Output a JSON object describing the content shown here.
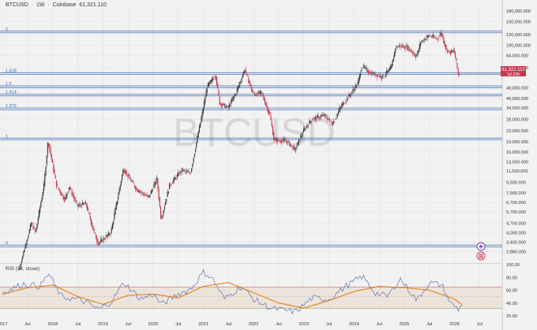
{
  "header": {
    "symbol": "BTCUSD",
    "sep": "·",
    "interval": "1W",
    "exchange": "Coinbase",
    "last": "61,321.110"
  },
  "watermark": "BTCUSD",
  "price_tag": {
    "value": "61,321.110",
    "countdown": "1d 23h"
  },
  "rsi_label": "RSI (14, close)",
  "colors": {
    "background": "#f2f2f2",
    "up": "#3a3a3a",
    "down": "#c8384f",
    "fib": "#2e5fb0",
    "rsi": "#6a7fb8",
    "rsi_ma": "#e07e1a",
    "rsi_band": "#e8d9c8",
    "upper_line": "#c86a6a"
  },
  "chart_data": [
    {
      "type": "line",
      "title": "BTCUSD",
      "scale": "log",
      "ylim": [
        2400,
        190000
      ],
      "x_ticks": [
        "2017",
        "Jul",
        "2018",
        "Jul",
        "2019",
        "Jul",
        "2020",
        "Jul",
        "2021",
        "Jul",
        "2022",
        "Jul",
        "2023",
        "Jul",
        "2024",
        "Jul",
        "2025",
        "Jul",
        "2026",
        "Jul"
      ],
      "y_ticks": [
        {
          "value": 180000,
          "label": "180,000.000"
        },
        {
          "value": 150000,
          "label": "150,000.000"
        },
        {
          "value": 120000,
          "label": "120,000.000"
        },
        {
          "value": 100000,
          "label": "100,000.000"
        },
        {
          "value": 84000,
          "label": "84,000.000"
        },
        {
          "value": 68000,
          "label": "68,000.000"
        },
        {
          "value": 48000,
          "label": "48,000.000"
        },
        {
          "value": 40000,
          "label": "40,000.000"
        },
        {
          "value": 34000,
          "label": "34,000.000"
        },
        {
          "value": 28000,
          "label": "28,000.000"
        },
        {
          "value": 23000,
          "label": "23,000.000"
        },
        {
          "value": 19000,
          "label": "19,000.000"
        },
        {
          "value": 16000,
          "label": "16,000.000"
        },
        {
          "value": 13500,
          "label": "13,500.000"
        },
        {
          "value": 11500,
          "label": "11,500.000"
        },
        {
          "value": 9500,
          "label": "9,500.000"
        },
        {
          "value": 7900,
          "label": "7,900.000"
        },
        {
          "value": 6700,
          "label": "6,700.000"
        },
        {
          "value": 5700,
          "label": "5,700.000"
        },
        {
          "value": 4700,
          "label": "4,700.000"
        },
        {
          "value": 4000,
          "label": "4,000.000"
        },
        {
          "value": 3400,
          "label": "3,400.000"
        },
        {
          "value": 2880,
          "label": "2,880.000"
        }
      ],
      "fib_levels": [
        {
          "label": "2",
          "price": 126000
        },
        {
          "label": "1.618",
          "price": 61500
        },
        {
          "label": "1.5",
          "price": 49000
        },
        {
          "label": "1.414",
          "price": 42500
        },
        {
          "label": "1.272",
          "price": 33500
        },
        {
          "label": "1",
          "price": 20000
        },
        {
          "label": "0",
          "price": 3180
        }
      ],
      "series": [
        {
          "x": [
            "2017-05",
            "2017-08",
            "2017-09",
            "2017-11",
            "2017-12",
            "2018-02",
            "2018-04",
            "2018-05",
            "2018-07",
            "2018-09",
            "2018-11",
            "2018-12",
            "2019-03",
            "2019-06",
            "2019-09",
            "2019-12",
            "2020-02",
            "2020-03",
            "2020-05",
            "2020-08",
            "2020-10",
            "2020-12",
            "2021-01",
            "2021-02",
            "2021-04",
            "2021-05",
            "2021-07",
            "2021-09",
            "2021-11",
            "2022-01",
            "2022-03",
            "2022-05",
            "2022-06",
            "2022-09",
            "2022-11",
            "2023-01",
            "2023-03",
            "2023-06",
            "2023-08",
            "2023-10",
            "2023-12",
            "2024-02",
            "2024-03",
            "2024-05",
            "2024-08",
            "2024-10",
            "2024-11",
            "2024-12",
            "2025-02",
            "2025-04",
            "2025-05",
            "2025-07",
            "2025-09",
            "2025-10",
            "2025-11",
            "2025-12",
            "2026-01",
            "2026-02"
          ],
          "values": [
            2100,
            4700,
            4000,
            9000,
            19500,
            9000,
            7000,
            8800,
            6300,
            6600,
            4000,
            3300,
            4000,
            12000,
            8500,
            7300,
            10000,
            5000,
            9000,
            11700,
            11000,
            23000,
            33000,
            49000,
            60000,
            37000,
            34000,
            45000,
            66000,
            43000,
            44000,
            30000,
            19500,
            19300,
            16500,
            23000,
            28000,
            30000,
            26000,
            35000,
            42000,
            52000,
            70000,
            62000,
            58000,
            68000,
            96000,
            99000,
            96000,
            82000,
            105000,
            118000,
            112000,
            124000,
            95000,
            88000,
            91000,
            61000
          ]
        }
      ]
    },
    {
      "type": "line",
      "title": "RSI (14, close)",
      "ylim": [
        20,
        100
      ],
      "y_ticks": [
        100,
        80,
        60,
        40,
        20
      ],
      "series": [
        {
          "name": "RSI",
          "x": [
            "2017-01",
            "2017-06",
            "2017-10",
            "2017-12",
            "2018-03",
            "2018-08",
            "2018-12",
            "2019-03",
            "2019-06",
            "2019-10",
            "2020-01",
            "2020-03",
            "2020-07",
            "2020-10",
            "2021-01",
            "2021-03",
            "2021-06",
            "2021-10",
            "2022-01",
            "2022-05",
            "2022-11",
            "2023-03",
            "2023-07",
            "2023-11",
            "2024-03",
            "2024-06",
            "2024-09",
            "2024-12",
            "2025-04",
            "2025-07",
            "2025-10",
            "2025-12",
            "2026-02",
            "2026-03"
          ],
          "values": [
            56,
            70,
            66,
            86,
            50,
            44,
            30,
            42,
            72,
            46,
            54,
            38,
            54,
            62,
            88,
            80,
            46,
            66,
            46,
            32,
            26,
            48,
            46,
            66,
            82,
            56,
            50,
            78,
            44,
            72,
            68,
            40,
            30,
            40
          ]
        },
        {
          "name": "MA",
          "x": [
            "2017-01",
            "2017-07",
            "2018-01",
            "2018-07",
            "2019-01",
            "2019-07",
            "2020-01",
            "2020-07",
            "2021-01",
            "2021-07",
            "2022-01",
            "2022-07",
            "2023-01",
            "2023-07",
            "2024-01",
            "2024-07",
            "2025-01",
            "2025-07",
            "2026-01",
            "2026-03"
          ],
          "values": [
            54,
            64,
            68,
            50,
            38,
            52,
            54,
            48,
            66,
            72,
            56,
            40,
            32,
            44,
            58,
            66,
            64,
            60,
            46,
            36
          ]
        }
      ]
    }
  ]
}
